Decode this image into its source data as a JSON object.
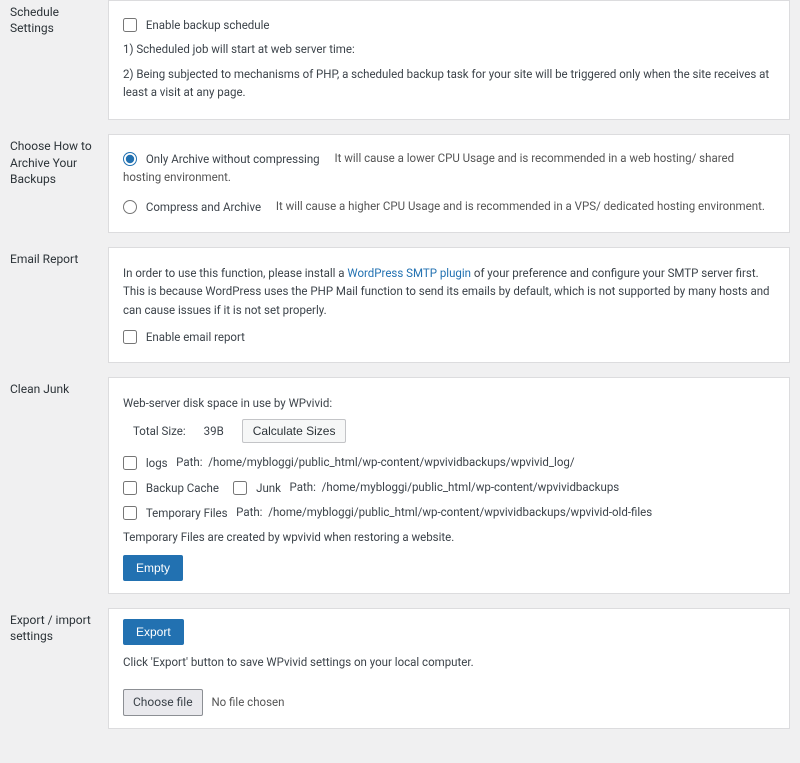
{
  "schedule": {
    "title": "Schedule Settings",
    "enable_label": "Enable backup schedule",
    "note1": "1) Scheduled job will start at web server time:",
    "note2": "2) Being subjected to mechanisms of PHP, a scheduled backup task for your site will be triggered only when the site receives at least a visit at any page."
  },
  "archive_mode": {
    "title": "Choose How to Archive Your Backups",
    "only_label": "Only Archive without compressing",
    "only_desc": "It will cause a lower CPU Usage and is recommended in a web hosting/ shared hosting environment.",
    "compress_label": "Compress and Archive",
    "compress_desc": "It will cause a higher CPU Usage and is recommended in a VPS/ dedicated hosting environment."
  },
  "email": {
    "title": "Email Report",
    "info_pre": "In order to use this function, please install a ",
    "info_link": "WordPress SMTP plugin",
    "info_post": " of your preference and configure your SMTP server first. This is because WordPress uses the PHP Mail function to send its emails by default, which is not supported by many hosts and can cause issues if it is not set properly.",
    "enable_label": "Enable email report"
  },
  "junk": {
    "title": "Clean Junk",
    "disk_label": "Web-server disk space in use by WPvivid:",
    "total_label": "Total Size:",
    "total_value": "39B",
    "calc_btn": "Calculate Sizes",
    "logs_label": "logs",
    "logs_path_label": "Path:",
    "logs_path": "/home/mybloggi/public_html/wp-content/wpvividbackups/wpvivid_log/",
    "cache_label": "Backup Cache",
    "junk_label": "Junk",
    "junk_path_label": "Path:",
    "junk_path": "/home/mybloggi/public_html/wp-content/wpvividbackups",
    "temp_label": "Temporary Files",
    "temp_path_label": "Path:",
    "temp_path": "/home/mybloggi/public_html/wp-content/wpvividbackups/wpvivid-old-files",
    "temp_note": "Temporary Files are created by wpvivid when restoring a website.",
    "empty_btn": "Empty"
  },
  "export": {
    "title": "Export / import settings",
    "export_btn": "Export",
    "export_note": "Click 'Export' button to save WPvivid settings on your local computer.",
    "choose_btn": "Choose file",
    "no_file": "No file chosen"
  }
}
